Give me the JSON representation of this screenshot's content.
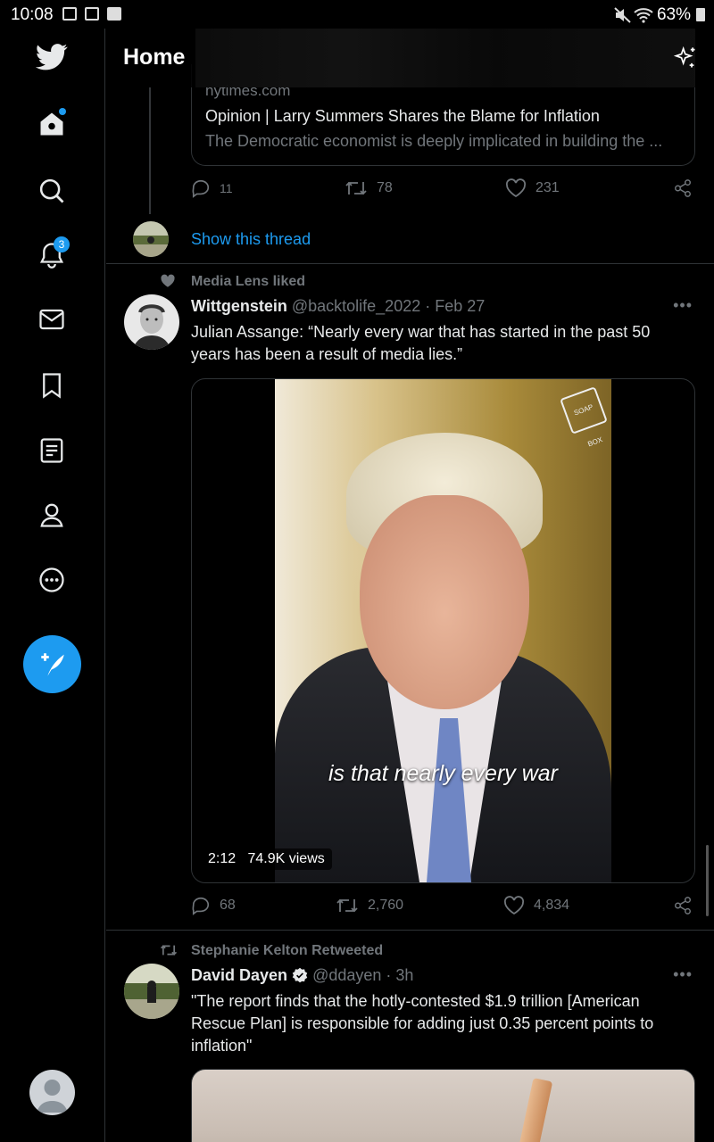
{
  "status_bar": {
    "time": "10:08",
    "battery": "63%"
  },
  "sidebar": {
    "items": [
      {
        "name": "home",
        "icon": "home-icon"
      },
      {
        "name": "explore",
        "icon": "search-icon"
      },
      {
        "name": "notifications",
        "icon": "bell-icon",
        "badge": "3"
      },
      {
        "name": "messages",
        "icon": "mail-icon"
      },
      {
        "name": "bookmarks",
        "icon": "bookmark-icon"
      },
      {
        "name": "lists",
        "icon": "list-icon"
      },
      {
        "name": "profile",
        "icon": "person-icon"
      },
      {
        "name": "more",
        "icon": "more-icon"
      }
    ],
    "accent": "#1d9bf0"
  },
  "header": {
    "title": "Home"
  },
  "tweet1": {
    "card": {
      "domain": "nytimes.com",
      "headline": "Opinion | Larry Summers Shares the Blame for Inflation",
      "description": "The Democratic economist is deeply implicated in building the ..."
    },
    "replies": "11",
    "retweets": "78",
    "likes": "231",
    "show_thread": "Show this thread"
  },
  "tweet2": {
    "social_context": "Media Lens liked",
    "author_name": "Wittgenstein",
    "handle": "@backtolife_2022",
    "date": "· Feb 27",
    "text": "Julian Assange: “Nearly every war that has started in the past 50 years has been a result of media lies.”",
    "video": {
      "caption": "is that nearly every war",
      "duration": "2:12",
      "views": "74.9K views",
      "watermark": "SOAP BOX"
    },
    "replies": "68",
    "retweets": "2,760",
    "likes": "4,834"
  },
  "tweet3": {
    "social_context": "Stephanie Kelton Retweeted",
    "author_name": "David Dayen",
    "handle": "@ddayen",
    "date": "· 3h",
    "text": "\"The report finds that the hotly-contested $1.9 trillion [American Rescue Plan] is responsible for adding just 0.35 percent points to inflation\""
  },
  "more_label": "•••"
}
